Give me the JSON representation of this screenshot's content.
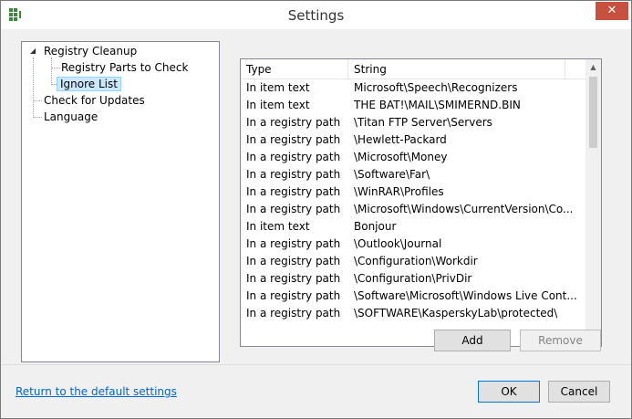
{
  "window": {
    "title": "Settings",
    "close_label": "✕"
  },
  "tree": {
    "items": [
      {
        "label": "Registry Cleanup",
        "level": 0,
        "expanded": true
      },
      {
        "label": "Registry Parts to Check",
        "level": 1
      },
      {
        "label": "Ignore List",
        "level": 1,
        "selected": true
      },
      {
        "label": "Check for Updates",
        "level": 0
      },
      {
        "label": "Language",
        "level": 0
      }
    ],
    "expander_glyph": "◢"
  },
  "list": {
    "columns": [
      "Type",
      "String"
    ],
    "rows": [
      [
        "In item text",
        "Microsoft\\Speech\\Recognizers"
      ],
      [
        "In item text",
        "THE BAT!\\MAIL\\SMIMERND.BIN"
      ],
      [
        "In a registry path",
        "\\Titan FTP Server\\Servers"
      ],
      [
        "In a registry path",
        "\\Hewlett-Packard"
      ],
      [
        "In a registry path",
        "\\Microsoft\\Money"
      ],
      [
        "In a registry path",
        "\\Software\\Far\\"
      ],
      [
        "In a registry path",
        "\\WinRAR\\Profiles"
      ],
      [
        "In a registry path",
        "\\Microsoft\\Windows\\CurrentVersion\\Co..."
      ],
      [
        "In item text",
        "Bonjour"
      ],
      [
        "In a registry path",
        "\\Outlook\\Journal"
      ],
      [
        "In a registry path",
        "\\Configuration\\Workdir"
      ],
      [
        "In a registry path",
        "\\Configuration\\PrivDir"
      ],
      [
        "In a registry path",
        "\\Software\\Microsoft\\Windows Live Cont..."
      ],
      [
        "In a registry path",
        "\\SOFTWARE\\KasperskyLab\\protected\\"
      ]
    ],
    "scroll_up": "▲",
    "scroll_down": "▼"
  },
  "buttons": {
    "add": "Add",
    "remove": "Remove",
    "ok": "OK",
    "cancel": "Cancel"
  },
  "footer": {
    "reset_link": "Return to the default settings"
  },
  "colors": {
    "selection_bg": "#cce8ff",
    "close_bg": "#c7503f",
    "link": "#0066cc",
    "accent": "#0078d7"
  }
}
